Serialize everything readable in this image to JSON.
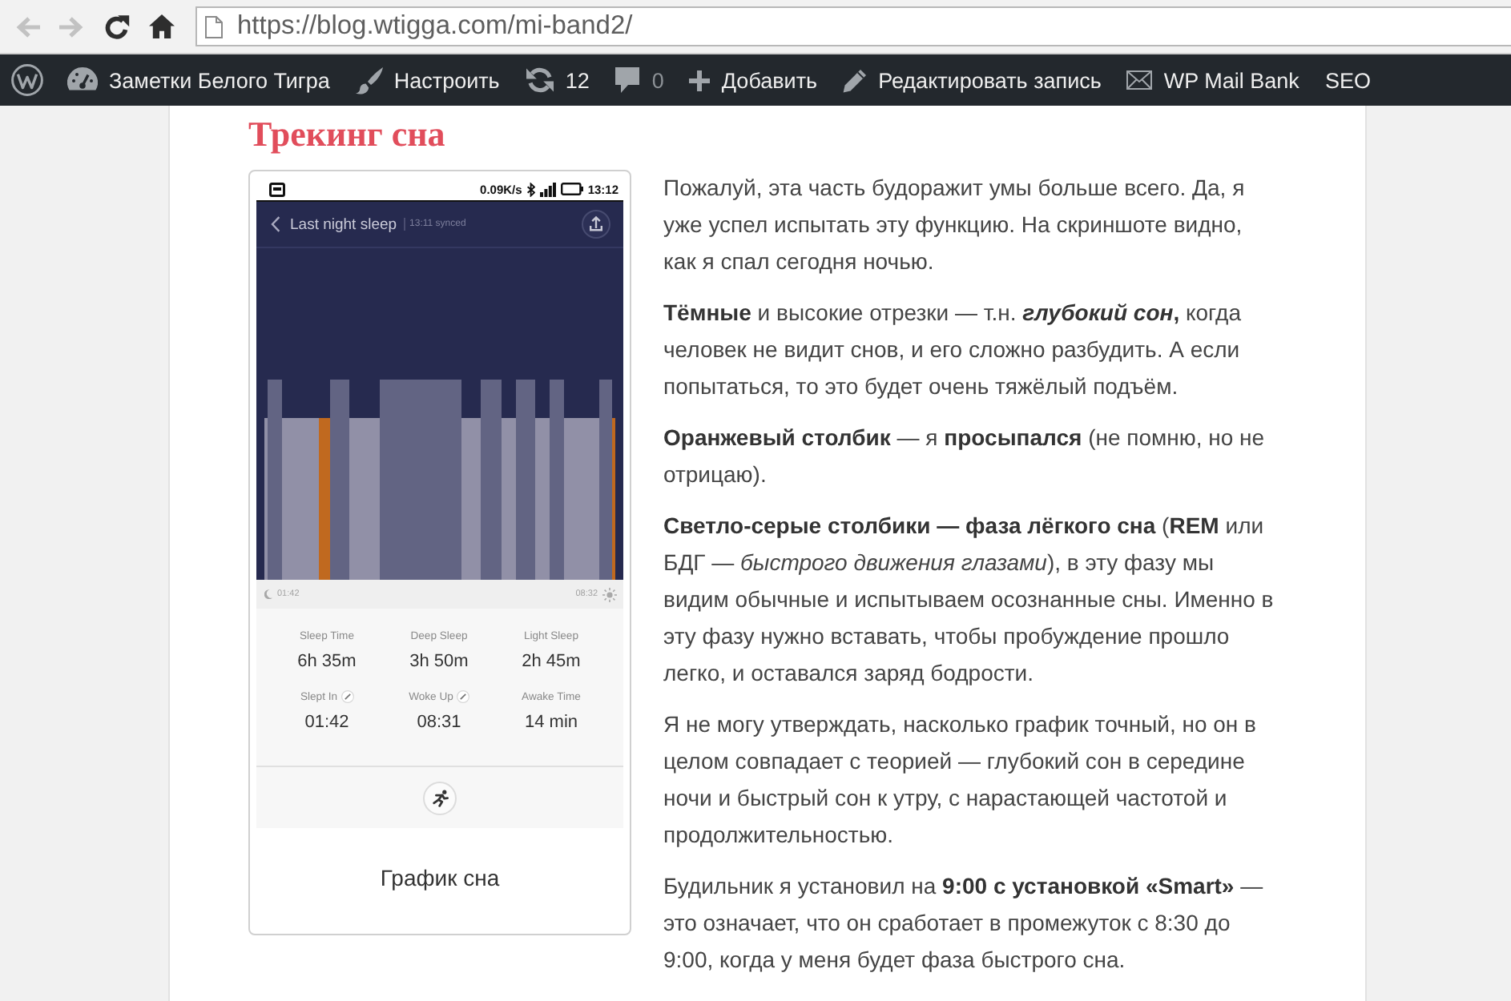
{
  "browser": {
    "nav": [
      {
        "kind": "back",
        "disabled": true
      },
      {
        "kind": "forward",
        "disabled": true
      },
      {
        "kind": "reload",
        "disabled": false
      },
      {
        "kind": "home",
        "disabled": false
      }
    ],
    "address": "https://blog.wtigga.com/mi-band2/"
  },
  "admin_bar": {
    "items": [
      {
        "kind": "logo"
      },
      {
        "kind": "site",
        "label": "Заметки Белого Тигра"
      },
      {
        "kind": "customize",
        "label": "Настроить"
      },
      {
        "kind": "updates",
        "label": "12"
      },
      {
        "kind": "comments",
        "label": "0"
      },
      {
        "kind": "new",
        "label": "Добавить"
      },
      {
        "kind": "edit",
        "label": "Редактировать запись"
      },
      {
        "kind": "mail",
        "label": "WP Mail Bank"
      },
      {
        "kind": "seo",
        "label": "SEO"
      }
    ]
  },
  "article": {
    "heading": "Трекинг сна",
    "figure": {
      "screenshot": {
        "status_bar": {
          "speed": "0.09K/s",
          "time": "13:12"
        },
        "header": {
          "title": "Last night sleep",
          "synced": "13:11 synced"
        },
        "timeline": {
          "start": "01:42",
          "end": "08:32"
        },
        "stats": [
          {
            "label": "Sleep Time",
            "value": "6h 35m",
            "editable": false
          },
          {
            "label": "Deep Sleep",
            "value": "3h 50m",
            "editable": false
          },
          {
            "label": "Light Sleep",
            "value": "2h 45m",
            "editable": false
          },
          {
            "label": "Slept In",
            "value": "01:42",
            "editable": true
          },
          {
            "label": "Woke Up",
            "value": "08:31",
            "editable": true
          },
          {
            "label": "Awake Time",
            "value": "14 min",
            "editable": false
          }
        ]
      },
      "caption": "График сна"
    },
    "paragraphs": [
      "Пожалуй, эта часть будоражит умы больше всего. Да, я уже успел испытать эту функцию. На скриншоте видно, как я спал сегодня ночью.",
      "**Тёмные** и высокие отрезки — т.н. ***глубокий сон*,** когда человек не видит снов, и его сложно разбудить. А если попытаться, то это будет очень тяжёлый подъём.",
      "**Оранжевый столбик** — я **просыпался** (не помню, но не отрицаю).",
      "**Светло-серые столбики — фаза лёгкого сна** (**REM** или БДГ — *быстрого движения глазами*), в эту фазу мы видим обычные и испытываем осознанные сны. Именно в эту фазу нужно вставать, чтобы пробуждение прошло легко, и оставался заряд бодрости.",
      "Я не могу утверждать, насколько график точный, но он в целом совпадает с теорией — глубокий сон в середине ночи и быстрый сон к утру, с нарастающей частотой и продолжительностью.",
      "Будильник я установил на **9:00 с установкой «Smart»** — это означает, что он сработает в промежуток с 8:30 до 9:00, когда у меня будет фаза быстрого сна."
    ]
  }
}
